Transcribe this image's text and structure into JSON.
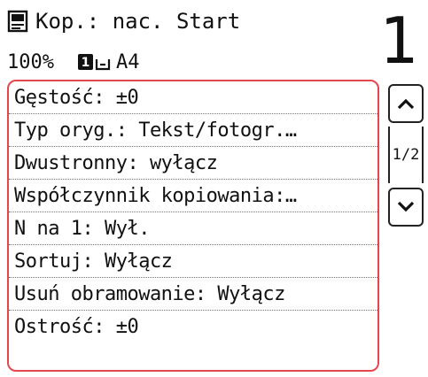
{
  "header": {
    "title": "Kop.: nac. Start",
    "zoom": "100%",
    "paper_size": "A4",
    "copy_count": "1",
    "icons": [
      "copy-document-icon",
      "duplex-icon"
    ]
  },
  "settings": {
    "items": [
      {
        "label": "Gęstość: ±0"
      },
      {
        "label": "Typ oryg.: Tekst/fotogr.…"
      },
      {
        "label": "Dwustronny: wyłącz"
      },
      {
        "label": "Współczynnik kopiowania:…"
      },
      {
        "label": "N na 1: Wył."
      },
      {
        "label": "Sortuj: Wyłącz"
      },
      {
        "label": "Usuń obramowanie: Wyłącz"
      },
      {
        "label": "Ostrość: ±0"
      }
    ],
    "page_indicator": "1/2",
    "accent_color": "#e4474e"
  }
}
